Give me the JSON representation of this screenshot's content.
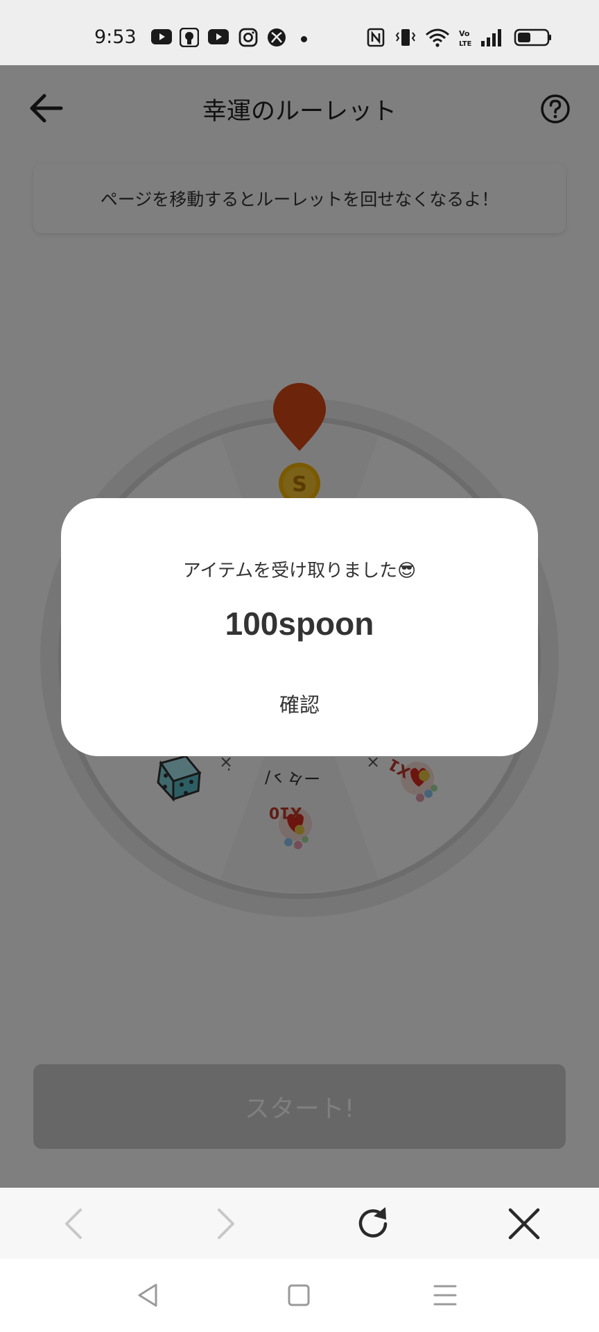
{
  "status_bar": {
    "time": "9:53",
    "left_icons": [
      "youtube-icon",
      "voice-recorder-icon",
      "youtube-icon",
      "instagram-icon",
      "xbox-icon",
      "more-dot-icon"
    ],
    "right_icons": [
      "nfc-icon",
      "vibrate-icon",
      "wifi-icon",
      "volte-icon",
      "signal-icon",
      "battery-icon"
    ]
  },
  "header": {
    "title": "幸運のルーレット",
    "back_icon": "arrow-left-icon",
    "help_icon": "question-circle-icon"
  },
  "notice": {
    "text": "ページを移動するとルーレットを回せなくなるよ！"
  },
  "roulette": {
    "pointer_icon": "map-pin-icon",
    "coin_icon": "spoon-coin-icon",
    "coin_letter": "S",
    "segment_labels": [
      "X10",
      "X1"
    ],
    "segment_icons": [
      "dice-icon",
      "heart-sticker-icon"
    ]
  },
  "start_button": {
    "label": "スタート!"
  },
  "modal": {
    "message": "アイテムを受け取りました😎",
    "value": "100spoon",
    "confirm_label": "確認"
  },
  "browser_toolbar": {
    "icons": [
      "chevron-left-icon",
      "chevron-right-icon",
      "refresh-icon",
      "close-icon"
    ]
  },
  "nav_bar": {
    "icons": [
      "nav-back-icon",
      "nav-home-icon",
      "nav-menu-icon"
    ]
  },
  "colors": {
    "pointer": "#d94817",
    "coin": "#f4b400",
    "overlay": "rgba(0,0,0,0.5)",
    "start_disabled": "#cfcfcf",
    "teal_dice": "#7fd0d8"
  }
}
